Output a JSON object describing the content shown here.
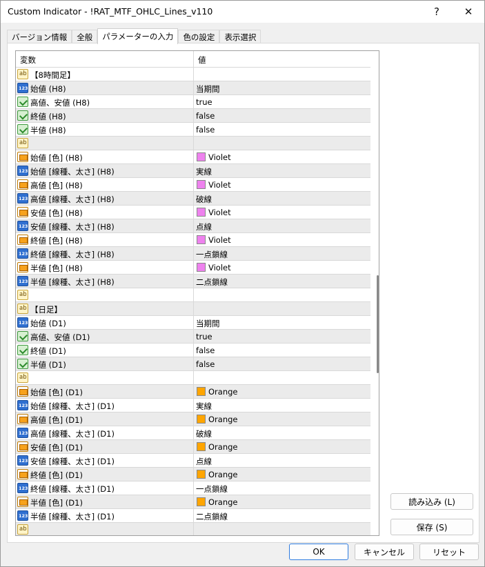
{
  "window": {
    "title": "Custom Indicator - !RAT_MTF_OHLC_Lines_v110",
    "help_label": "?",
    "close_label": "✕"
  },
  "tabs": [
    {
      "label": "バージョン情報",
      "active": false
    },
    {
      "label": "全般",
      "active": false
    },
    {
      "label": "パラメーターの入力",
      "active": true
    },
    {
      "label": "色の設定",
      "active": false
    },
    {
      "label": "表示選択",
      "active": false
    }
  ],
  "grid": {
    "col_variable": "変数",
    "col_value": "値",
    "rows": [
      {
        "icon": "string",
        "name": "【8時間足】",
        "value": ""
      },
      {
        "icon": "integer",
        "name": "始値 (H8)",
        "value": "当期間"
      },
      {
        "icon": "boolean",
        "name": "高値、安値 (H8)",
        "value": "true"
      },
      {
        "icon": "boolean",
        "name": "終値 (H8)",
        "value": "false"
      },
      {
        "icon": "boolean",
        "name": "半値 (H8)",
        "value": "false"
      },
      {
        "icon": "string",
        "name": "",
        "value": ""
      },
      {
        "icon": "color",
        "name": "始値 [色] (H8)",
        "value": "Violet",
        "swatch": "#ee82ee"
      },
      {
        "icon": "integer",
        "name": "始値 [線種、太さ] (H8)",
        "value": "実線"
      },
      {
        "icon": "color",
        "name": "高値 [色] (H8)",
        "value": "Violet",
        "swatch": "#ee82ee"
      },
      {
        "icon": "integer",
        "name": "高値 [線種、太さ] (H8)",
        "value": "破線"
      },
      {
        "icon": "color",
        "name": "安値 [色] (H8)",
        "value": "Violet",
        "swatch": "#ee82ee"
      },
      {
        "icon": "integer",
        "name": "安値 [線種、太さ] (H8)",
        "value": "点線"
      },
      {
        "icon": "color",
        "name": "終値 [色] (H8)",
        "value": "Violet",
        "swatch": "#ee82ee"
      },
      {
        "icon": "integer",
        "name": "終値 [線種、太さ] (H8)",
        "value": "一点鎖線"
      },
      {
        "icon": "color",
        "name": "半値 [色] (H8)",
        "value": "Violet",
        "swatch": "#ee82ee"
      },
      {
        "icon": "integer",
        "name": "半値 [線種、太さ] (H8)",
        "value": "二点鎖線"
      },
      {
        "icon": "string",
        "name": "",
        "value": ""
      },
      {
        "icon": "string",
        "name": "【日足】",
        "value": ""
      },
      {
        "icon": "integer",
        "name": "始値 (D1)",
        "value": "当期間"
      },
      {
        "icon": "boolean",
        "name": "高値、安値 (D1)",
        "value": "true"
      },
      {
        "icon": "boolean",
        "name": "終値 (D1)",
        "value": "false"
      },
      {
        "icon": "boolean",
        "name": "半値 (D1)",
        "value": "false"
      },
      {
        "icon": "string",
        "name": "",
        "value": ""
      },
      {
        "icon": "color",
        "name": "始値 [色] (D1)",
        "value": "Orange",
        "swatch": "#ffa500"
      },
      {
        "icon": "integer",
        "name": "始値 [線種、太さ] (D1)",
        "value": "実線"
      },
      {
        "icon": "color",
        "name": "高値 [色] (D1)",
        "value": "Orange",
        "swatch": "#ffa500"
      },
      {
        "icon": "integer",
        "name": "高値 [線種、太さ] (D1)",
        "value": "破線"
      },
      {
        "icon": "color",
        "name": "安値 [色] (D1)",
        "value": "Orange",
        "swatch": "#ffa500"
      },
      {
        "icon": "integer",
        "name": "安値 [線種、太さ] (D1)",
        "value": "点線"
      },
      {
        "icon": "color",
        "name": "終値 [色] (D1)",
        "value": "Orange",
        "swatch": "#ffa500"
      },
      {
        "icon": "integer",
        "name": "終値 [線種、太さ] (D1)",
        "value": "一点鎖線"
      },
      {
        "icon": "color",
        "name": "半値 [色] (D1)",
        "value": "Orange",
        "swatch": "#ffa500"
      },
      {
        "icon": "integer",
        "name": "半値 [線種、太さ] (D1)",
        "value": "二点鎖線"
      },
      {
        "icon": "string",
        "name": "",
        "value": ""
      }
    ]
  },
  "side_buttons": {
    "load_label": "読み込み (L)",
    "save_label": "保存 (S)"
  },
  "footer_buttons": {
    "ok_label": "OK",
    "cancel_label": "キャンセル",
    "reset_label": "リセット"
  },
  "colors": {
    "violet": "#ee82ee",
    "orange": "#ffa500",
    "primary_border": "#2d7be0"
  }
}
